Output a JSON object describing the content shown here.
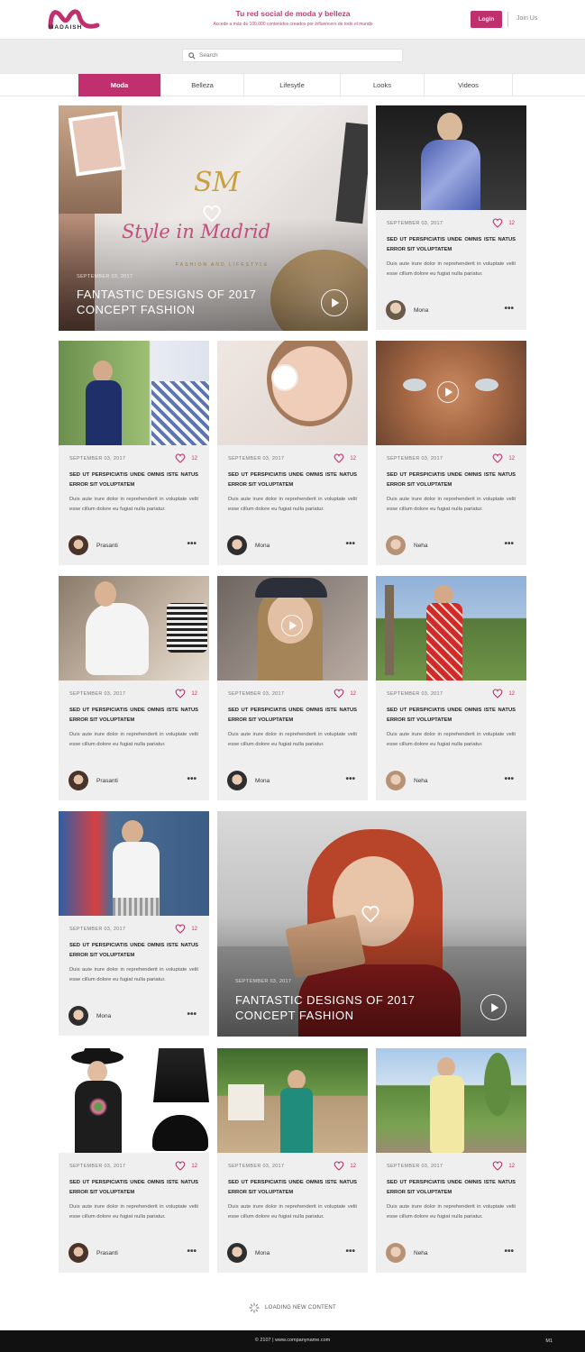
{
  "brand": {
    "logo_text": "MADAISH",
    "accent_color": "#c0306e",
    "tagline_title": "Tu red social de moda y belleza",
    "tagline_sub": "Accede a más de 100.000 contenidos creados por influencers de todo el mundo"
  },
  "header": {
    "login_label": "Login",
    "join_label": "Join Us"
  },
  "search": {
    "placeholder": "Search",
    "icon": "search-icon"
  },
  "tabs": [
    {
      "label": "Moda",
      "active": true
    },
    {
      "label": "Belleza",
      "active": false
    },
    {
      "label": "Lifesytle",
      "active": false
    },
    {
      "label": "Looks",
      "active": false
    },
    {
      "label": "Videos",
      "active": false
    }
  ],
  "features": [
    {
      "image_text": "Style in Madrid",
      "image_sub": "FASHION AND LIFESTYLE",
      "date": "SEPTEMBER 03, 2017",
      "title": "FANTASTIC DESIGNS OF 2017 CONCEPT FASHION"
    },
    {
      "date": "SEPTEMBER 03, 2017",
      "title": "FANTASTIC DESIGNS OF 2017 CONCEPT FASHION"
    }
  ],
  "cards": [
    {
      "date": "SEPTEMBER 03, 2017",
      "likes": "12",
      "title": "SED UT PERSPICIATIS UNDE OMNIS ISTE NATUS ERROR SIT VOLUPTATEM",
      "excerpt": "Duis aute irure dolor in reprehenderit in voluptate velit esse cillum dolore eu fugiat nulla pariatur.",
      "author": "Mona"
    },
    {
      "date": "SEPTEMBER 03, 2017",
      "likes": "12",
      "title": "SED UT PERSPICIATIS UNDE OMNIS ISTE NATUS ERROR SIT VOLUPTATEM",
      "excerpt": "Duis aute irure dolor in reprehenderit in voluptate velit esse cillum dolore eu fugiat nulla pariatur.",
      "author": "Prasanti"
    },
    {
      "date": "SEPTEMBER 03, 2017",
      "likes": "12",
      "title": "SED UT PERSPICIATIS UNDE OMNIS ISTE NATUS ERROR SIT VOLUPTATEM",
      "excerpt": "Duis aute irure dolor in reprehenderit in voluptate velit esse cillum dolore eu fugiat nulla pariatur.",
      "author": "Mona"
    },
    {
      "date": "SEPTEMBER 03, 2017",
      "likes": "12",
      "title": "SED UT PERSPICIATIS UNDE OMNIS ISTE NATUS ERROR SIT VOLUPTATEM",
      "excerpt": "Duis aute irure dolor in reprehenderit in voluptate velit esse cillum dolore eu fugiat nulla pariatur.",
      "author": "Neha"
    },
    {
      "date": "SEPTEMBER 03, 2017",
      "likes": "12",
      "title": "SED UT PERSPICIATIS UNDE OMNIS ISTE NATUS ERROR SIT VOLUPTATEM",
      "excerpt": "Duis aute irure dolor in reprehenderit in voluptate velit esse cillum dolore eu fugiat nulla pariatur.",
      "author": "Prasanti"
    },
    {
      "date": "SEPTEMBER 03, 2017",
      "likes": "12",
      "title": "SED UT PERSPICIATIS UNDE OMNIS ISTE NATUS ERROR SIT VOLUPTATEM",
      "excerpt": "Duis aute irure dolor in reprehenderit in voluptate velit esse cillum dolore eu fugiat nulla pariatur.",
      "author": "Mona"
    },
    {
      "date": "SEPTEMBER 03, 2017",
      "likes": "12",
      "title": "SED UT PERSPICIATIS UNDE OMNIS ISTE NATUS ERROR SIT VOLUPTATEM",
      "excerpt": "Duis aute irure dolor in reprehenderit in voluptate velit esse cillum dolore eu fugiat nulla pariatur.",
      "author": "Neha"
    },
    {
      "date": "SEPTEMBER 03, 2017",
      "likes": "12",
      "title": "SED UT PERSPICIATIS UNDE OMNIS ISTE NATUS ERROR SIT VOLUPTATEM",
      "excerpt": "Duis aute irure dolor in reprehenderit in voluptate velit esse cillum dolore eu fugiat nulla pariatur.",
      "author": "Mona"
    },
    {
      "date": "SEPTEMBER 03, 2017",
      "likes": "12",
      "title": "SED UT PERSPICIATIS UNDE OMNIS ISTE NATUS ERROR SIT VOLUPTATEM",
      "excerpt": "Duis aute irure dolor in reprehenderit in voluptate velit esse cillum dolore eu fugiat nulla pariatur.",
      "author": "Prasanti"
    },
    {
      "date": "SEPTEMBER 03, 2017",
      "likes": "12",
      "title": "SED UT PERSPICIATIS UNDE OMNIS ISTE NATUS ERROR SIT VOLUPTATEM",
      "excerpt": "Duis aute irure dolor in reprehenderit in voluptate velit esse cillum dolore eu fugiat nulla pariatur.",
      "author": "Mona"
    },
    {
      "date": "SEPTEMBER 03, 2017",
      "likes": "12",
      "title": "SED UT PERSPICIATIS UNDE OMNIS ISTE NATUS ERROR SIT VOLUPTATEM",
      "excerpt": "Duis aute irure dolor in reprehenderit in voluptate velit esse cillum dolore eu fugiat nulla pariatur.",
      "author": "Neha"
    }
  ],
  "loading_text": "LOADING NEW CONTENT",
  "footer": {
    "text": "© 2107  |  www.companyname.com",
    "right": "M1"
  }
}
